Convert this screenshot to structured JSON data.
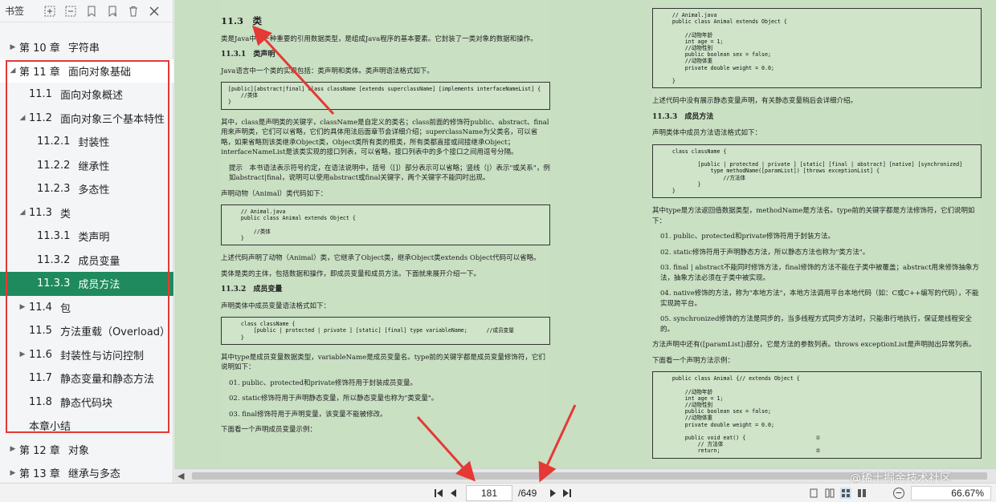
{
  "sidebar": {
    "title": "书签",
    "tools": [
      "expand-all-icon",
      "collapse-all-icon",
      "add-bookmark-icon",
      "bookmark-icon",
      "delete-icon",
      "close-icon"
    ],
    "items": [
      {
        "level": 0,
        "arrow": "▶",
        "num": "第 10 章",
        "label": "字符串"
      },
      {
        "level": 0,
        "arrow": "◢",
        "num": "第 11 章",
        "label": "面向对象基础"
      },
      {
        "level": 1,
        "arrow": "",
        "num": "11.1",
        "label": "面向对象概述"
      },
      {
        "level": 1,
        "arrow": "◢",
        "num": "11.2",
        "label": "面向对象三个基本特性"
      },
      {
        "level": 2,
        "arrow": "",
        "num": "11.2.1",
        "label": "封装性"
      },
      {
        "level": 2,
        "arrow": "",
        "num": "11.2.2",
        "label": "继承性"
      },
      {
        "level": 2,
        "arrow": "",
        "num": "11.2.3",
        "label": "多态性"
      },
      {
        "level": 1,
        "arrow": "◢",
        "num": "11.3",
        "label": "类"
      },
      {
        "level": 2,
        "arrow": "",
        "num": "11.3.1",
        "label": "类声明"
      },
      {
        "level": 2,
        "arrow": "",
        "num": "11.3.2",
        "label": "成员变量"
      },
      {
        "level": 2,
        "arrow": "",
        "num": "11.3.3",
        "label": "成员方法",
        "selected": true
      },
      {
        "level": 1,
        "arrow": "▶",
        "num": "11.4",
        "label": "包"
      },
      {
        "level": 1,
        "arrow": "",
        "num": "11.5",
        "label": "方法重载（Overload）"
      },
      {
        "level": 1,
        "arrow": "▶",
        "num": "11.6",
        "label": "封装性与访问控制"
      },
      {
        "level": 1,
        "arrow": "",
        "num": "11.7",
        "label": "静态变量和静态方法"
      },
      {
        "level": 1,
        "arrow": "",
        "num": "11.8",
        "label": "静态代码块"
      },
      {
        "level": 1,
        "arrow": "",
        "num": "",
        "label": "本章小结"
      },
      {
        "level": 0,
        "arrow": "▶",
        "num": "第 12 章",
        "label": "对象"
      },
      {
        "level": 0,
        "arrow": "▶",
        "num": "第 13 章",
        "label": "继承与多态"
      }
    ]
  },
  "left_page": {
    "section": "11.3　类",
    "p1": "类是Java中的一种重要的引用数据类型，是组成Java程序的基本要素。它封装了一类对象的数据和操作。",
    "sub1": "11.3.1　类声明",
    "p2": "Java语言中一个类的实现包括：类声明和类体。类声明语法格式如下。",
    "code1": "[public][abstract|final] class className [extends superclassName] [implements interfaceNameList] {\n    //类体\n}",
    "p3": "其中，class是声明类的关键字，className是自定义的类名；class前面的修饰符public、abstract、final用来声明类，它们可以省略，它们的具体用法后面章节会详细介绍；superclassName为父类名，可以省略，如果省略则该类继承Object类，Object类所有类的根类，所有类都直接或间接继承Object；interfaceNameList是该类实现的接口列表，可以省略，接口列表中的多个接口之间用逗号分隔。",
    "tip": "提示　本书语法表示符号约定，在语法说明中，括号（[]）部分表示可以省略；竖线（|）表示\"或关系\"，例如abstract|final，说明可以使用abstract或final关键字，两个关键字不能同时出现。",
    "p4": "声明动物（Animal）类代码如下：",
    "code2": "    // Animal.java\n    public class Animal extends Object {\n\n        //类体\n    }",
    "p5": "上述代码声明了动物（Animal）类，它继承了Object类，继承Object类extends Object代码可以省略。",
    "p6": "类体是类的主体，包括数据和操作，即成员变量和成员方法。下面就来展开介绍一下。",
    "sub2": "11.3.2　成员变量",
    "p7": "声明类体中成员变量语法格式如下：",
    "code3": "    class className {\n        [public | protected | private ] [static] [final] type variableName;      //成员变量\n    }",
    "p8": "其中type是成员变量数据类型，variableName是成员变量名。type前的关键字都是成员变量修饰符，它们说明如下：",
    "li1": "01.  public、protected和private修饰符用于封装成员变量。",
    "li2": "02.  static修饰符用于声明静态变量，所以静态变量也称为\"类变量\"。",
    "li3": "03.  final修饰符用于声明变量，该变量不能被修改。",
    "p9": "下面看一个声明成员变量示例："
  },
  "right_page": {
    "code1": "    // Animal.java\n    public class Animal extends Object {\n\n        //动物年龄\n        int age = 1;\n        //动物性别\n        public boolean sex = false;\n        //动物体重\n        private double weight = 0.0;\n\n    }",
    "p1": "上述代码中没有展示静态变量声明，有关静态变量稍后会详细介绍。",
    "sub1": "11.3.3　成员方法",
    "p2": "声明类体中成员方法语法格式如下：",
    "code2": "    class className {\n\n            [public | protected | private ] [static] [final | abstract] [native] [synchronized]\n                type methodName([paramList]) [throws exceptionList] {\n                    //方法体\n            }\n    }",
    "p3": "其中type是方法返回值数据类型，methodName是方法名。type前的关键字都是方法修饰符，它们说明如下：",
    "li1": "01.  public、protected和private修饰符用于封装方法。",
    "li2": "02.  static修饰符用于声明静态方法，所以静态方法也称为\"类方法\"。",
    "li3": "03.  final | abstract不能同时修饰方法，final修饰的方法不能在子类中被覆盖；abstract用来修饰抽象方法，抽象方法必须在子类中被实现。",
    "li4": "04.  native修饰的方法，称为\"本地方法\"，本地方法调用平台本地代码（如：C或C++编写的代码），不能实现跨平台。",
    "li5": "05.  synchronized修饰的方法是同步的，当多线程方式同步方法时，只能串行地执行，保证是线程安全的。",
    "p4": "方法声明中还有([paramList])部分，它是方法的参数列表。throws exceptionList是声明抛出异常列表。",
    "p5": "下面看一个声明方法示例：",
    "code3": "    public class Animal {// extends Object {\n\n        //动物年龄\n        int age = 1;\n        //动物性别\n        public boolean sex = false;\n        //动物体重\n        private double weight = 0.0;\n\n        public void eat() {                      ①\n            // 方法体\n            return;                              ②"
  },
  "statusbar": {
    "current_page": "181",
    "total_pages": "/649",
    "zoom": "66.67%",
    "zoom_out": "−"
  },
  "watermark": "@稀土掘金技术社区",
  "colors": {
    "selected": "#1f8a5d",
    "annotation_red": "#e53935",
    "page_bg": "#c9e0c3"
  }
}
